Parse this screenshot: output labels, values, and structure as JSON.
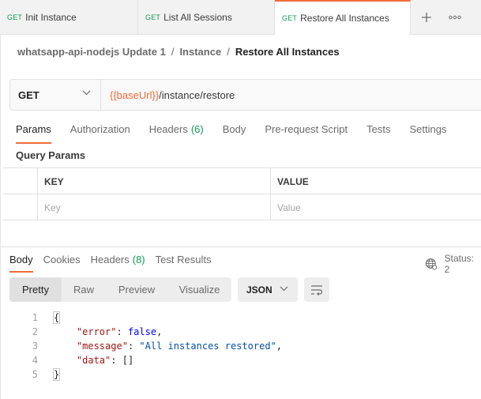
{
  "tabs": [
    {
      "method": "GET",
      "label": "Init Instance",
      "active": false
    },
    {
      "method": "GET",
      "label": "List All Sessions",
      "active": false
    },
    {
      "method": "GET",
      "label": "Restore All Instances",
      "active": true
    }
  ],
  "tab_controls": {
    "add_icon": "plus-icon",
    "more_icon": "more-horizontal-icon"
  },
  "breadcrumb": {
    "collection": "whatsapp-api-nodejs Update 1",
    "folder": "Instance",
    "request": "Restore All Instances",
    "separator": "/"
  },
  "request": {
    "method": "GET",
    "url_variable": "{{baseUrl}}",
    "url_path": "/instance/restore"
  },
  "request_tabs": [
    {
      "label": "Params",
      "count": "",
      "active": true
    },
    {
      "label": "Authorization",
      "count": "",
      "active": false
    },
    {
      "label": "Headers",
      "count": "(6)",
      "active": false
    },
    {
      "label": "Body",
      "count": "",
      "active": false
    },
    {
      "label": "Pre-request Script",
      "count": "",
      "active": false
    },
    {
      "label": "Tests",
      "count": "",
      "active": false
    },
    {
      "label": "Settings",
      "count": "",
      "active": false
    }
  ],
  "query_params": {
    "title": "Query Params",
    "headers": {
      "key": "KEY",
      "value": "VALUE"
    },
    "placeholders": {
      "key": "Key",
      "value": "Value"
    }
  },
  "response_tabs": [
    {
      "label": "Body",
      "count": "",
      "active": true
    },
    {
      "label": "Cookies",
      "count": "",
      "active": false
    },
    {
      "label": "Headers",
      "count": "(8)",
      "active": false
    },
    {
      "label": "Test Results",
      "count": "",
      "active": false
    }
  ],
  "status": {
    "label": "Status: 2",
    "icon": "globe-icon"
  },
  "view_modes": [
    {
      "label": "Pretty",
      "active": true
    },
    {
      "label": "Raw",
      "active": false
    },
    {
      "label": "Preview",
      "active": false
    },
    {
      "label": "Visualize",
      "active": false
    }
  ],
  "format": {
    "selected": "JSON"
  },
  "code_lines": [
    {
      "num": "1",
      "text": "{"
    },
    {
      "num": "2",
      "key": "\"error\"",
      "value": "false",
      "value_type": "keyword",
      "trail": ","
    },
    {
      "num": "3",
      "key": "\"message\"",
      "value": "\"All instances restored\"",
      "value_type": "string",
      "trail": ","
    },
    {
      "num": "4",
      "key": "\"data\"",
      "value": "[]",
      "value_type": "plain",
      "trail": ""
    },
    {
      "num": "5",
      "text": "}"
    }
  ],
  "colors": {
    "accent": "#f26b3a",
    "method_get": "#0f9d58",
    "json_key": "#a31515",
    "json_string": "#0451a5",
    "json_keyword": "#0000ff"
  }
}
